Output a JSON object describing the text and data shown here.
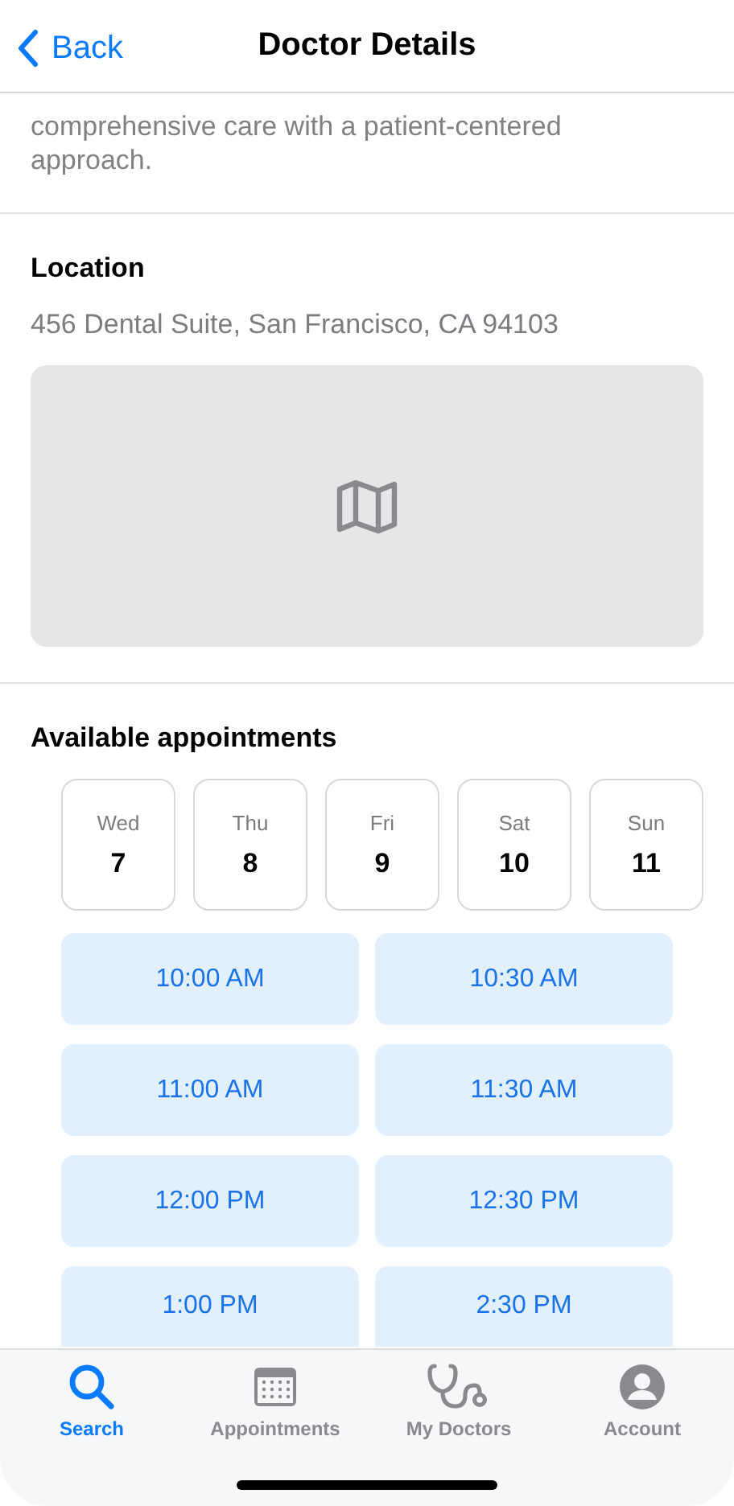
{
  "nav": {
    "back": "Back",
    "title": "Doctor Details"
  },
  "description": "comprehensive care with a patient-centered approach.",
  "location": {
    "heading": "Location",
    "address": "456 Dental Suite, San Francisco, CA 94103",
    "map": {
      "kind": "placeholder"
    }
  },
  "appointments": {
    "heading": "Available appointments",
    "days": [
      {
        "weekday": "Wed",
        "date": "7"
      },
      {
        "weekday": "Thu",
        "date": "8"
      },
      {
        "weekday": "Fri",
        "date": "9"
      },
      {
        "weekday": "Sat",
        "date": "10"
      },
      {
        "weekday": "Sun",
        "date": "11"
      }
    ],
    "slots": [
      "10:00 AM",
      "10:30 AM",
      "11:00 AM",
      "11:30 AM",
      "12:00 PM",
      "12:30 PM",
      "1:00 PM",
      "2:30 PM"
    ]
  },
  "tab_bar": [
    {
      "label": "Search",
      "selected": true
    },
    {
      "label": "Appointments",
      "selected": false
    },
    {
      "label": "My Doctors",
      "selected": false
    },
    {
      "label": "Account",
      "selected": false
    }
  ]
}
